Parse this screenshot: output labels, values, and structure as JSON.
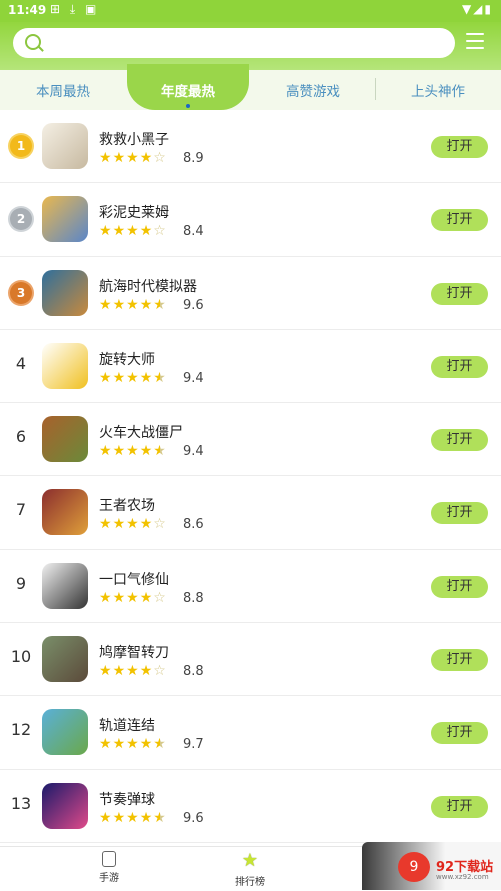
{
  "status": {
    "time": "11:49",
    "left_icons": "⊞ ⤓ ▣",
    "right_icons": "▼◢▮"
  },
  "search": {
    "placeholder": ""
  },
  "tabs": [
    {
      "label": "本周最热",
      "active": false
    },
    {
      "label": "年度最热",
      "active": true
    },
    {
      "label": "高赞游戏",
      "active": false
    },
    {
      "label": "上头神作",
      "active": false
    }
  ],
  "open_label": "打开",
  "apps": [
    {
      "rank": "1",
      "medal": "gold",
      "name": "救救小黑子",
      "stars": 4,
      "half": false,
      "score": "8.9",
      "colors": [
        "#f4efe4",
        "#c7b9a0"
      ],
      "icon": "cartoon-icon"
    },
    {
      "rank": "2",
      "medal": "silver",
      "name": "彩泥史莱姆",
      "stars": 4,
      "half": false,
      "score": "8.4",
      "colors": [
        "#e9b84f",
        "#5a86c9"
      ],
      "icon": "slime-icon"
    },
    {
      "rank": "3",
      "medal": "bronze",
      "name": "航海时代模拟器",
      "stars": 4,
      "half": true,
      "score": "9.6",
      "colors": [
        "#2f6f9c",
        "#c98a3c"
      ],
      "icon": "ship-icon"
    },
    {
      "rank": "4",
      "medal": "",
      "name": "旋转大师",
      "stars": 4,
      "half": true,
      "score": "9.4",
      "colors": [
        "#ffffff",
        "#f0c020"
      ],
      "icon": "figure-icon"
    },
    {
      "rank": "6",
      "medal": "",
      "name": "火车大战僵尸",
      "stars": 4,
      "half": true,
      "score": "9.4",
      "colors": [
        "#a8612c",
        "#6b8a3a"
      ],
      "icon": "train-icon"
    },
    {
      "rank": "7",
      "medal": "",
      "name": "王者农场",
      "stars": 4,
      "half": false,
      "score": "8.6",
      "colors": [
        "#8b2e2e",
        "#e0a03a"
      ],
      "icon": "hero-icon"
    },
    {
      "rank": "9",
      "medal": "",
      "name": "一口气修仙",
      "stars": 4,
      "half": false,
      "score": "8.8",
      "colors": [
        "#f1f1f1",
        "#333333"
      ],
      "icon": "monk-icon"
    },
    {
      "rank": "10",
      "medal": "",
      "name": "鸠摩智转刀",
      "stars": 4,
      "half": false,
      "score": "8.8",
      "colors": [
        "#7a8f6a",
        "#5b4a3a"
      ],
      "icon": "warrior-icon"
    },
    {
      "rank": "12",
      "medal": "",
      "name": "轨道连结",
      "stars": 4,
      "half": true,
      "score": "9.7",
      "colors": [
        "#5ab0d8",
        "#6aa84a"
      ],
      "icon": "rail-icon"
    },
    {
      "rank": "13",
      "medal": "",
      "name": "节奏弹球",
      "stars": 4,
      "half": true,
      "score": "9.6",
      "colors": [
        "#1a1a6a",
        "#e04a8a"
      ],
      "icon": "ball-icon"
    }
  ],
  "nav": {
    "games": "手游",
    "ranking": "排行榜"
  },
  "watermark": {
    "logo": "9",
    "text": "92下载站",
    "url": "www.xz92.com"
  }
}
